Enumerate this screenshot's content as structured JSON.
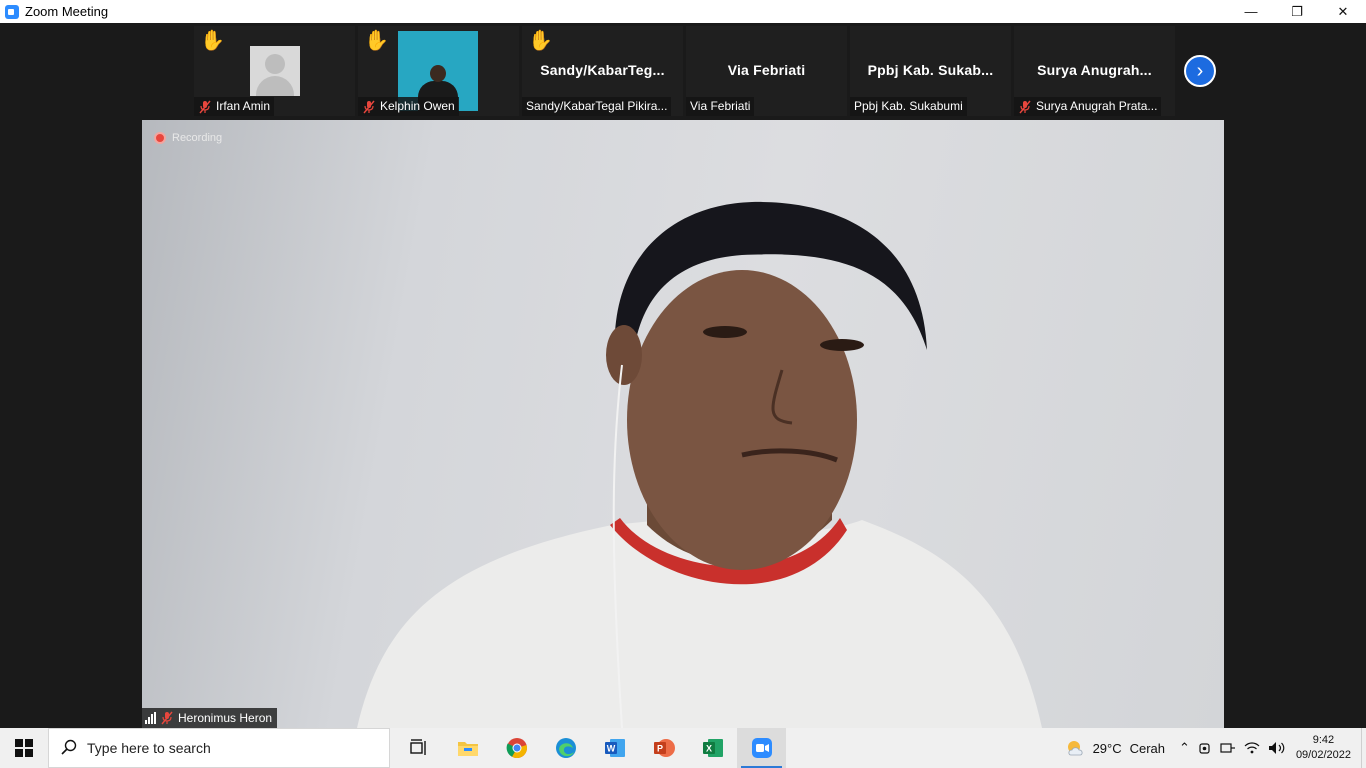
{
  "window": {
    "title": "Zoom Meeting",
    "controls": {
      "minimize": "—",
      "restore": "❐",
      "close": "✕"
    }
  },
  "participants": [
    {
      "name": "Irfan Amin",
      "label": "Irfan Amin",
      "hand_raised": true,
      "muted": true,
      "display": "avatar"
    },
    {
      "name": "Kelphin Owen",
      "label": "Kelphin Owen",
      "hand_raised": true,
      "muted": true,
      "display": "video"
    },
    {
      "name": "Sandy/KabarTeg...",
      "label": "Sandy/KabarTegal Pikira...",
      "hand_raised": true,
      "muted": false,
      "display": "name"
    },
    {
      "name": "Via Febriati",
      "label": "Via Febriati",
      "hand_raised": false,
      "muted": false,
      "display": "name"
    },
    {
      "name": "Ppbj  Kab.  Sukab...",
      "label": "Ppbj Kab. Sukabumi",
      "hand_raised": false,
      "muted": false,
      "display": "name"
    },
    {
      "name": "Surya  Anugrah...",
      "label": "Surya Anugrah Prata...",
      "hand_raised": false,
      "muted": true,
      "display": "name"
    }
  ],
  "main_video": {
    "recording_label": "Recording",
    "speaker_name": "Heronimus Heron"
  },
  "taskbar": {
    "search_placeholder": "Type here to search",
    "apps": [
      "task-view",
      "file-explorer",
      "chrome",
      "edge",
      "word",
      "powerpoint",
      "excel",
      "zoom"
    ],
    "active_app": "zoom",
    "weather": {
      "temp": "29°C",
      "condition": "Cerah"
    },
    "time": "9:42",
    "date": "09/02/2022"
  },
  "colors": {
    "accent": "#2d8cff",
    "next_button": "#1c6be0",
    "recording": "#e8463d",
    "mute": "#e8463d"
  }
}
